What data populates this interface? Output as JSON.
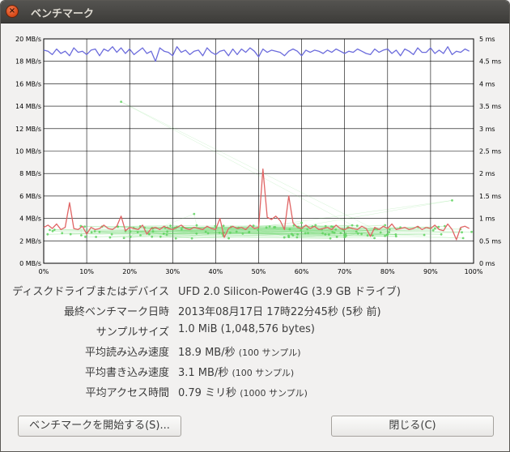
{
  "window": {
    "title": "ベンチマーク",
    "close_glyph": "×"
  },
  "chart_data": {
    "type": "line",
    "left_axis": {
      "unit": "MB/s",
      "ticks": [
        "0 MB/s",
        "2 MB/s",
        "4 MB/s",
        "6 MB/s",
        "8 MB/s",
        "10 MB/s",
        "12 MB/s",
        "14 MB/s",
        "16 MB/s",
        "18 MB/s",
        "20 MB/s"
      ],
      "ylim": [
        0,
        20
      ]
    },
    "right_axis": {
      "unit": "ms",
      "ticks": [
        "0 ms",
        "0.5 ms",
        "1 ms",
        "1.5 ms",
        "2 ms",
        "2.5 ms",
        "3 ms",
        "3.5 ms",
        "4 ms",
        "4.5 ms",
        "5 ms"
      ],
      "ylim": [
        0,
        5
      ]
    },
    "x_axis": {
      "ticks": [
        "0%",
        "10%",
        "20%",
        "30%",
        "40%",
        "50%",
        "60%",
        "70%",
        "80%",
        "90%",
        "100%"
      ],
      "xlim": [
        0,
        100
      ]
    },
    "grid": true,
    "colors": {
      "read": "#6b6bdc",
      "write": "#e06464",
      "access": "#5fd25f"
    },
    "series": [
      {
        "key": "read",
        "axis": "left",
        "x": [
          0,
          1,
          2,
          3,
          4,
          5,
          6,
          7,
          8,
          9,
          10,
          11,
          12,
          13,
          14,
          15,
          16,
          17,
          18,
          19,
          20,
          21,
          22,
          23,
          24,
          25,
          26,
          27,
          28,
          29,
          30,
          31,
          32,
          33,
          34,
          35,
          36,
          37,
          38,
          39,
          40,
          41,
          42,
          43,
          44,
          45,
          46,
          47,
          48,
          49,
          50,
          51,
          52,
          53,
          54,
          55,
          56,
          57,
          58,
          59,
          60,
          61,
          62,
          63,
          64,
          65,
          66,
          67,
          68,
          69,
          70,
          71,
          72,
          73,
          74,
          75,
          76,
          77,
          78,
          79,
          80,
          81,
          82,
          83,
          84,
          85,
          86,
          87,
          88,
          89,
          90,
          91,
          92,
          93,
          94,
          95,
          96,
          97,
          98,
          99
        ],
        "values": [
          19.0,
          18.9,
          18.6,
          19.1,
          18.7,
          18.9,
          18.5,
          19.2,
          18.8,
          18.9,
          18.6,
          19.0,
          19.1,
          18.5,
          19.1,
          18.9,
          19.3,
          18.8,
          19.2,
          18.7,
          19.1,
          18.6,
          18.9,
          19.2,
          18.7,
          18.9,
          18.0,
          19.2,
          18.9,
          18.8,
          18.5,
          19.3,
          18.8,
          19.0,
          18.6,
          18.9,
          19.0,
          18.5,
          19.2,
          18.8,
          18.6,
          18.9,
          19.0,
          18.5,
          19.1,
          18.6,
          19.1,
          18.8,
          19.2,
          18.9,
          18.4,
          19.1,
          18.8,
          19.0,
          18.9,
          18.8,
          18.5,
          18.9,
          19.1,
          18.9,
          18.5,
          19.0,
          18.8,
          19.0,
          18.9,
          18.7,
          19.0,
          18.8,
          19.1,
          18.9,
          18.7,
          18.9,
          18.8,
          19.1,
          18.9,
          18.7,
          18.6,
          19.1,
          18.8,
          19.0,
          19.1,
          18.7,
          19.0,
          18.5,
          19.1,
          18.9,
          18.6,
          19.2,
          18.8,
          18.8,
          19.2,
          18.7,
          19.0,
          18.7,
          19.3,
          18.6,
          18.9,
          18.8,
          19.1,
          18.9
        ]
      },
      {
        "key": "write",
        "axis": "left",
        "x": [
          0,
          1,
          2,
          3,
          4,
          5,
          6,
          7,
          8,
          9,
          10,
          11,
          12,
          13,
          14,
          15,
          16,
          17,
          18,
          19,
          20,
          21,
          22,
          23,
          24,
          25,
          26,
          27,
          28,
          29,
          30,
          31,
          32,
          33,
          34,
          35,
          36,
          37,
          38,
          39,
          40,
          41,
          42,
          43,
          44,
          45,
          46,
          47,
          48,
          49,
          50,
          51,
          52,
          53,
          54,
          55,
          56,
          57,
          58,
          59,
          60,
          61,
          62,
          63,
          64,
          65,
          66,
          67,
          68,
          69,
          70,
          71,
          72,
          73,
          74,
          75,
          76,
          77,
          78,
          79,
          80,
          81,
          82,
          83,
          84,
          85,
          86,
          87,
          88,
          89,
          90,
          91,
          92,
          93,
          94,
          95,
          96,
          97,
          98,
          99
        ],
        "values": [
          3.2,
          3.4,
          3.1,
          3.5,
          3.0,
          3.2,
          5.4,
          3.1,
          3.0,
          3.3,
          2.6,
          3.2,
          3.0,
          3.1,
          3.4,
          3.1,
          3.0,
          3.3,
          4.2,
          2.9,
          3.2,
          3.1,
          3.0,
          3.4,
          2.6,
          3.1,
          3.2,
          3.0,
          3.3,
          3.1,
          3.0,
          3.2,
          3.4,
          3.1,
          3.0,
          3.2,
          3.1,
          3.0,
          3.3,
          3.1,
          3.0,
          4.0,
          2.3,
          3.1,
          3.3,
          3.1,
          3.2,
          3.0,
          3.4,
          3.1,
          3.2,
          8.4,
          4.1,
          3.9,
          4.2,
          3.8,
          3.0,
          6.0,
          3.6,
          3.2,
          3.1,
          3.4,
          3.1,
          3.3,
          3.0,
          3.1,
          3.2,
          3.0,
          3.4,
          3.1,
          3.0,
          3.2,
          3.1,
          3.0,
          3.3,
          3.1,
          2.4,
          3.2,
          3.0,
          3.3,
          3.1,
          3.5,
          3.0,
          3.1,
          3.2,
          3.0,
          3.1,
          3.3,
          3.0,
          3.2,
          3.1,
          3.4,
          3.0,
          2.9,
          3.5,
          3.0,
          2.1,
          3.2,
          3.3,
          3.1
        ]
      }
    ],
    "access_scatter": {
      "axis": "right",
      "count": 1000,
      "x_range": [
        0,
        100
      ],
      "y_range": [
        0.55,
        0.85
      ],
      "outliers": [
        [
          18,
          3.6
        ],
        [
          95,
          1.4
        ],
        [
          60,
          0.9
        ],
        [
          35,
          1.1
        ]
      ]
    }
  },
  "info": [
    {
      "label": "ディスクドライブまたはデバイス",
      "value": "UFD 2.0 Silicon-Power4G (3.9 GB ドライブ)",
      "sub": ""
    },
    {
      "label": "最終ベンチマーク日時",
      "value": "2013年08月17日 17時22分45秒 (5秒 前)",
      "sub": ""
    },
    {
      "label": "サンプルサイズ",
      "value": "1.0 MiB (1,048,576 bytes)",
      "sub": ""
    },
    {
      "label": "平均読み込み速度",
      "value": "18.9 MB/秒",
      "sub": "(100 サンプル)"
    },
    {
      "label": "平均書き込み速度",
      "value": "3.1 MB/秒",
      "sub": "(100 サンプル)"
    },
    {
      "label": "平均アクセス時間",
      "value": "0.79 ミリ秒",
      "sub": "(1000 サンプル)"
    }
  ],
  "buttons": {
    "start_benchmark": "ベンチマークを開始する(S)...",
    "close": "閉じる(C)"
  }
}
